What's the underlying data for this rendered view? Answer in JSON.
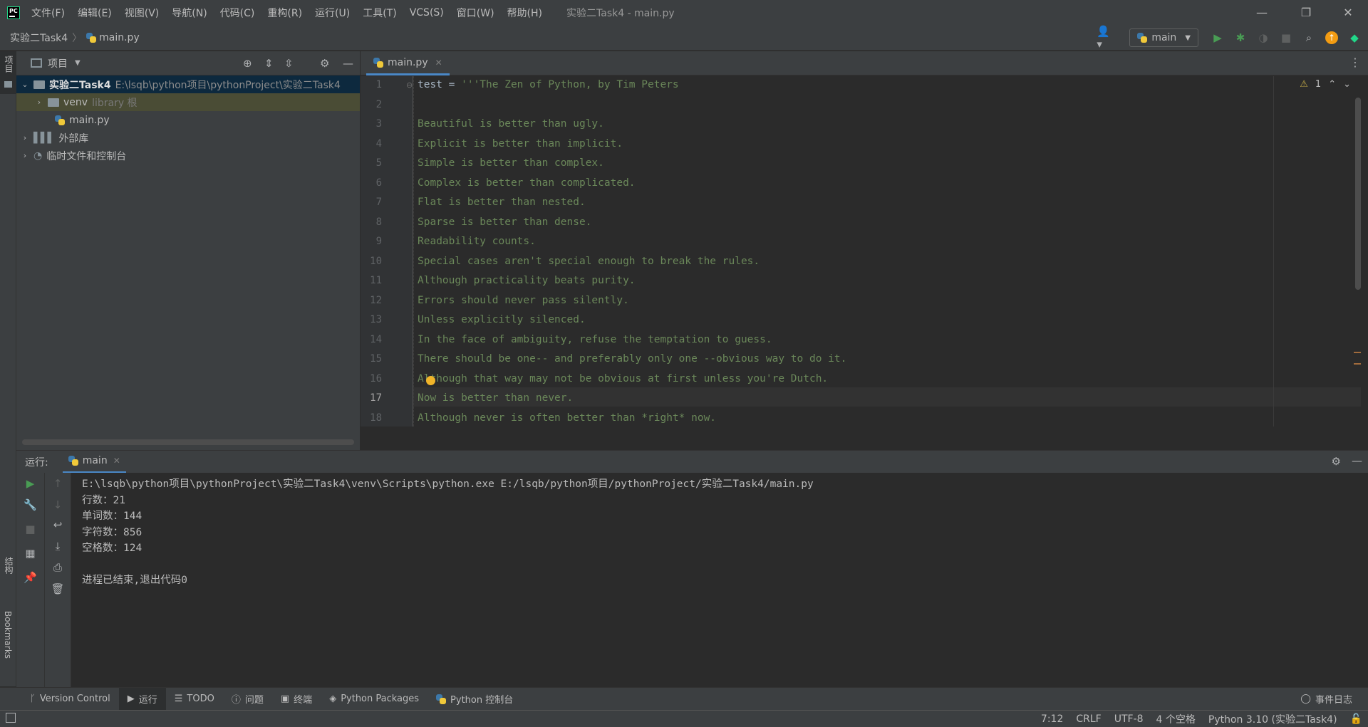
{
  "window": {
    "title": "实验二Task4 - main.py",
    "minimize": "—",
    "restore": "❐",
    "close": "✕"
  },
  "menu": [
    "文件(F)",
    "编辑(E)",
    "视图(V)",
    "导航(N)",
    "代码(C)",
    "重构(R)",
    "运行(U)",
    "工具(T)",
    "VCS(S)",
    "窗口(W)",
    "帮助(H)"
  ],
  "breadcrumb": {
    "project": "实验二Task4",
    "file": "main.py"
  },
  "run_config": {
    "label": "main"
  },
  "left_stripe": {
    "project": "项目",
    "structure": "结构",
    "bookmarks": "Bookmarks"
  },
  "project_panel": {
    "title": "项目",
    "root": {
      "name": "实验二Task4",
      "path": "E:\\lsqb\\python项目\\pythonProject\\实验二Task4"
    },
    "venv": {
      "name": "venv",
      "note": "library 根"
    },
    "file": "main.py",
    "external_libs": "外部库",
    "scratches": "临时文件和控制台"
  },
  "editor": {
    "tab": "main.py",
    "warnings": "1",
    "current_line": 17,
    "lines": [
      "test = '''The Zen of Python, by Tim Peters",
      "",
      "Beautiful is better than ugly.",
      "Explicit is better than implicit.",
      "Simple is better than complex.",
      "Complex is better than complicated.",
      "Flat is better than nested.",
      "Sparse is better than dense.",
      "Readability counts.",
      "Special cases aren't special enough to break the rules.",
      "Although practicality beats purity.",
      "Errors should never pass silently.",
      "Unless explicitly silenced.",
      "In the face of ambiguity, refuse the temptation to guess.",
      "There should be one-- and preferably only one --obvious way to do it.",
      "Although that way may not be obvious at first unless you're Dutch.",
      "Now is better than never.",
      "Although never is often better than *right* now."
    ]
  },
  "run_panel": {
    "label": "运行:",
    "tab": "main",
    "output": [
      "E:\\lsqb\\python项目\\pythonProject\\实验二Task4\\venv\\Scripts\\python.exe E:/lsqb/python项目/pythonProject/实验二Task4/main.py",
      "行数：21",
      "单词数：144",
      "字符数：856",
      "空格数：124",
      "",
      "进程已结束,退出代码0"
    ]
  },
  "bottom_tabs": [
    "Version Control",
    "运行",
    "TODO",
    "问题",
    "终端",
    "Python Packages",
    "Python 控制台"
  ],
  "event_log": "事件日志",
  "status": {
    "position": "7:12",
    "line_sep": "CRLF",
    "encoding": "UTF-8",
    "indent": "4 个空格",
    "interpreter": "Python 3.10 (实验二Task4)"
  },
  "colors": {
    "string": "#6a8759",
    "accent": "#4a88c7",
    "run_green": "#499c54",
    "background": "#2b2b2b",
    "panel": "#3c3f41"
  }
}
